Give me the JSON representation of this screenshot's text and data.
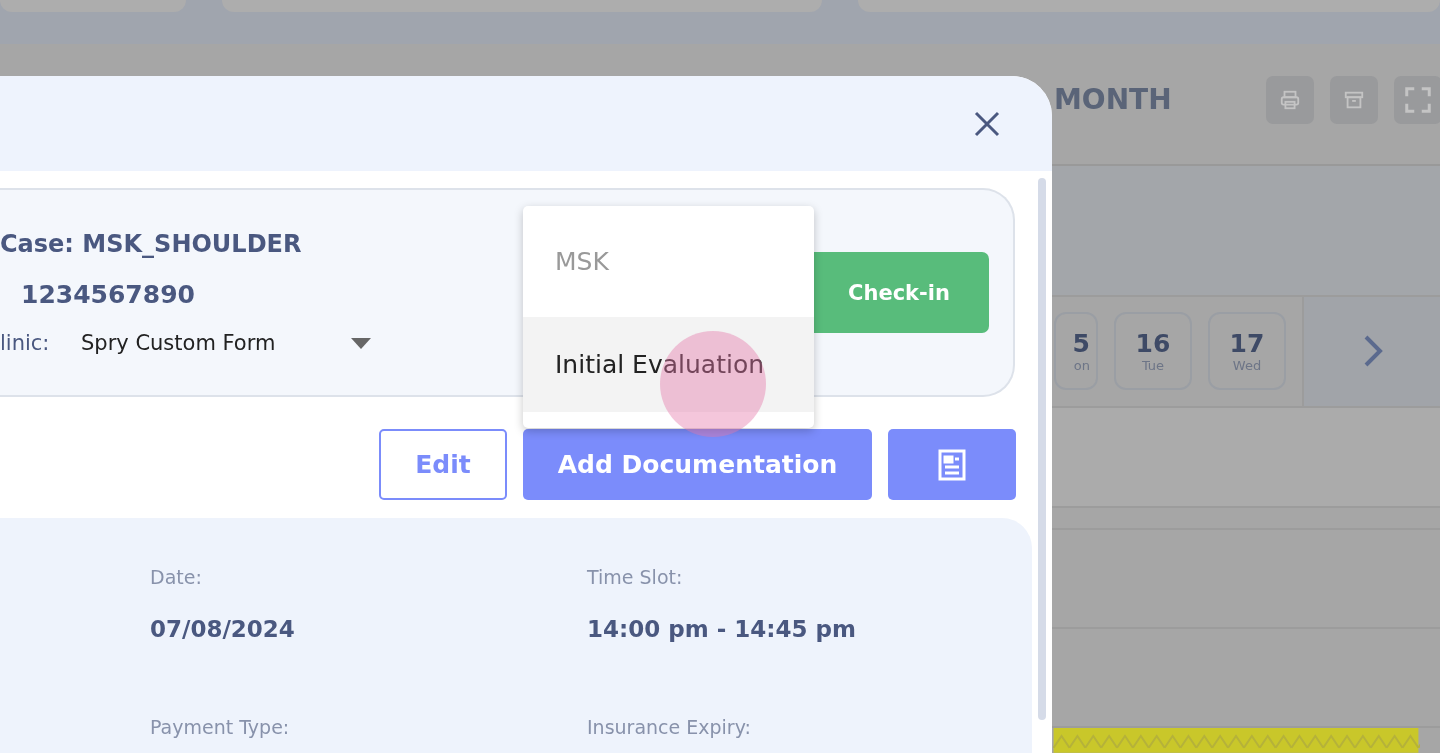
{
  "background": {
    "view_label": "MONTH",
    "days": [
      {
        "number": "5",
        "weekday": "on"
      },
      {
        "number": "16",
        "weekday": "Tue"
      },
      {
        "number": "17",
        "weekday": "Wed"
      }
    ]
  },
  "modal": {
    "case": {
      "title": "Case: MSK_SHOULDER",
      "id": "1234567890",
      "clinic_label": "linic:",
      "clinic_value": "Spry Custom Form"
    },
    "check_in": "Check-in",
    "menu": [
      {
        "label": "MSK",
        "kind": "group",
        "selected": false
      },
      {
        "label": "Initial Evaluation",
        "kind": "option",
        "selected": true
      }
    ],
    "actions": {
      "edit": "Edit",
      "add": "Add Documentation"
    },
    "details": [
      {
        "label": "Date:",
        "value": "07/08/2024"
      },
      {
        "label": "Time Slot:",
        "value": "14:00 pm - 14:45 pm"
      },
      {
        "label": "Payment Type:"
      },
      {
        "label": "Insurance Expiry:"
      }
    ]
  }
}
